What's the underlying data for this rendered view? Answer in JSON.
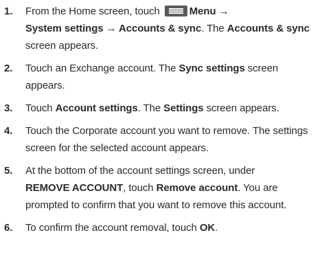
{
  "steps": [
    {
      "number": "1.",
      "t1": "From the Home screen, touch ",
      "icon": "menu-icon",
      "b1": "Menu →",
      "b2": "System settings → Accounts & sync",
      "t2": ". The ",
      "b3": "Accounts & sync",
      "t3": " screen appears."
    },
    {
      "number": "2.",
      "t1": "Touch an Exchange account. The ",
      "b1": "Sync settings",
      "t2": "  screen appears."
    },
    {
      "number": "3.",
      "t1": "Touch ",
      "b1": "Account settings",
      "t2": ". The ",
      "b2": "Settings",
      "t3": " screen appears."
    },
    {
      "number": "4.",
      "t1": "Touch the Corporate account you want to remove. The settings screen for the selected account appears."
    },
    {
      "number": "5.",
      "t1": "At the bottom of the account settings screen, under ",
      "b1": "REMOVE ACCOUNT",
      "t2": ", touch ",
      "b2": "Remove account",
      "t3": ".  You are prompted to confirm that you want to remove this account."
    },
    {
      "number": "6.",
      "t1": "To confirm the account removal, touch ",
      "b1": "OK",
      "t2": "."
    }
  ]
}
